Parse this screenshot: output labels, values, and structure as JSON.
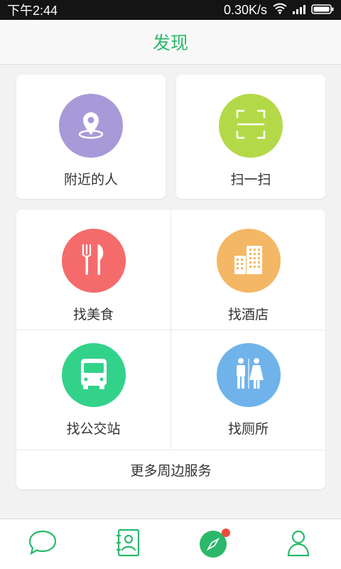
{
  "status_bar": {
    "time": "下午2:44",
    "network_speed": "0.30K/s",
    "icons": [
      "wifi-icon",
      "signal-icon",
      "battery-icon"
    ]
  },
  "header": {
    "title": "发现"
  },
  "top_cards": [
    {
      "label": "附近的人",
      "icon": "location-pin-icon",
      "color": "#a89ad8"
    },
    {
      "label": "扫一扫",
      "icon": "scan-icon",
      "color": "#b4d948"
    }
  ],
  "services": [
    {
      "label": "找美食",
      "icon": "fork-knife-icon",
      "color": "#f56b6b"
    },
    {
      "label": "找酒店",
      "icon": "buildings-icon",
      "color": "#f3b765"
    },
    {
      "label": "找公交站",
      "icon": "bus-icon",
      "color": "#33d28b"
    },
    {
      "label": "找厕所",
      "icon": "restroom-icon",
      "color": "#6fb3ea"
    }
  ],
  "more_services": "更多周边服务",
  "tab_bar": {
    "tabs": [
      "chat-icon",
      "contacts-icon",
      "discover-compass-icon",
      "profile-icon"
    ],
    "active": 2,
    "accent": "#2bb86a"
  }
}
